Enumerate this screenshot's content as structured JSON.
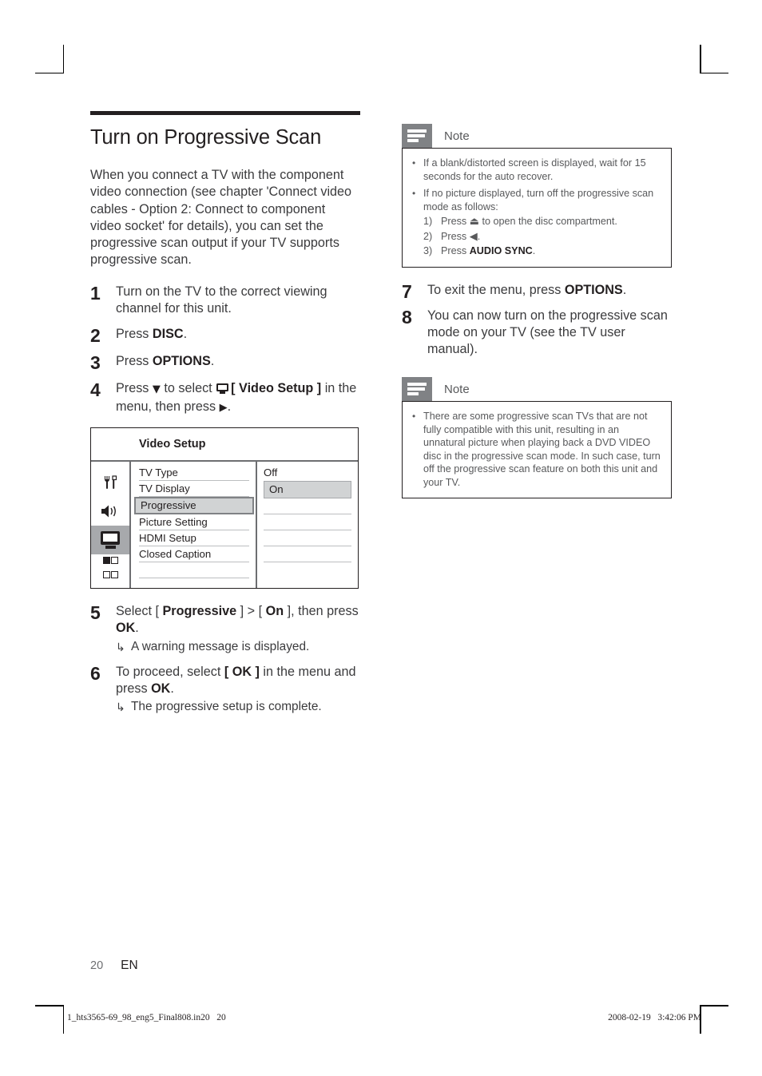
{
  "document": {
    "heading": "Turn on Progressive Scan",
    "intro": "When you connect a TV with the component video connection (see chapter 'Connect video cables - Option 2: Connect to component video socket' for details), you can set the progressive scan output if your TV supports progressive scan."
  },
  "steps_left": [
    {
      "num": "1",
      "text": "Turn on the TV to the correct viewing channel for this unit."
    },
    {
      "num": "2",
      "pre": "Press ",
      "bold": "DISC",
      "post": "."
    },
    {
      "num": "3",
      "pre": "Press ",
      "bold": "OPTIONS",
      "post": "."
    },
    {
      "num": "4",
      "pre": "Press ",
      "arrow_down": "▼",
      "mid": " to select ",
      "bold": "[ Video Setup ]",
      "post": " in the menu, then press ",
      "arrow_right": "▶",
      "end": "."
    },
    {
      "num": "5",
      "pre": "Select [ ",
      "bold": "Progressive",
      "mid": " ] > [ ",
      "bold2": "On",
      "post": " ], then press ",
      "bold3": "OK",
      "end": ".",
      "result_arrow": "↳",
      "result": "A warning message is displayed."
    },
    {
      "num": "6",
      "pre": "To proceed, select ",
      "bold": "[ OK ]",
      "post": " in the menu and press ",
      "bold2": "OK",
      "end": ".",
      "result_arrow": "↳",
      "result": "The progressive setup is complete."
    }
  ],
  "osd_menu": {
    "title": "Video Setup",
    "icons": [
      {
        "name": "tools-icon",
        "selected": false
      },
      {
        "name": "speaker-icon",
        "selected": false
      },
      {
        "name": "tv-icon",
        "selected": true
      },
      {
        "name": "grid-icon",
        "selected": false
      }
    ],
    "items": [
      {
        "label": "TV Type",
        "highlighted": false
      },
      {
        "label": "TV Display",
        "highlighted": false
      },
      {
        "label": "Progressive",
        "highlighted": true
      },
      {
        "label": "Picture Setting",
        "highlighted": false
      },
      {
        "label": "HDMI Setup",
        "highlighted": false
      },
      {
        "label": "Closed Caption",
        "highlighted": false
      },
      {
        "label": "",
        "highlighted": false
      }
    ],
    "values": [
      {
        "label": "Off",
        "highlighted": false
      },
      {
        "label": "On",
        "highlighted": true
      },
      {
        "label": "",
        "highlighted": false
      },
      {
        "label": "",
        "highlighted": false
      },
      {
        "label": "",
        "highlighted": false
      },
      {
        "label": "",
        "highlighted": false
      }
    ]
  },
  "note_top": {
    "label": "Note",
    "bullets": [
      {
        "text": "If a blank/distorted screen is displayed, wait for 15 seconds for the auto recover."
      },
      {
        "text": "If no picture displayed, turn off the progressive scan mode as follows:",
        "sub": [
          {
            "idx": "1)",
            "pre": "Press ",
            "glyph": "⏏",
            "post": " to open the disc compartment."
          },
          {
            "idx": "2)",
            "pre": "Press ",
            "glyph": "◀",
            "post": "."
          },
          {
            "idx": "3)",
            "pre": "Press ",
            "bold": "AUDIO SYNC",
            "post": "."
          }
        ]
      }
    ]
  },
  "steps_right": [
    {
      "num": "7",
      "pre": "To exit the menu, press ",
      "bold": "OPTIONS",
      "post": "."
    },
    {
      "num": "8",
      "text": "You can now turn on the progressive scan mode on your TV (see the TV user manual)."
    }
  ],
  "note_bottom": {
    "label": "Note",
    "bullets": [
      {
        "text": "There are some progressive scan TVs that are not fully compatible with this unit, resulting in an unnatural picture when playing back a DVD VIDEO disc in the progressive scan mode. In such case, turn off the progressive scan feature on both this unit and your TV."
      }
    ]
  },
  "footer": {
    "page_number": "20",
    "language": "EN",
    "press_filename": "1_hts3565-69_98_eng5_Final808.in20   20",
    "press_timestamp": "2008-02-19   3:42:06 PM"
  },
  "colors": {
    "ink": "#231f20",
    "body_text": "#3b3b3d",
    "note_gray": "#808285",
    "highlight_fill": "#d1d3d4",
    "rail_line": "#6d6e71"
  }
}
